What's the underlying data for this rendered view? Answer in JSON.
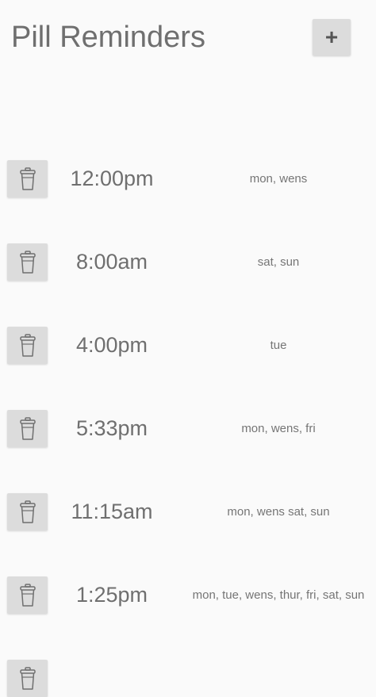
{
  "header": {
    "title": "Pill Reminders",
    "add_label": "+"
  },
  "reminders": [
    {
      "time": "12:00pm",
      "days": "mon, wens"
    },
    {
      "time": "8:00am",
      "days": "sat, sun"
    },
    {
      "time": "4:00pm",
      "days": "tue"
    },
    {
      "time": "5:33pm",
      "days": "mon, wens, fri"
    },
    {
      "time": "11:15am",
      "days": "mon, wens sat, sun"
    },
    {
      "time": "1:25pm",
      "days": "mon, tue, wens, thur, fri, sat, sun"
    },
    {
      "time": "",
      "days": ""
    }
  ],
  "icons": {
    "delete": "trash-icon"
  },
  "colors": {
    "background": "#fafafa",
    "button": "#dcdcdc",
    "text": "#757575"
  }
}
